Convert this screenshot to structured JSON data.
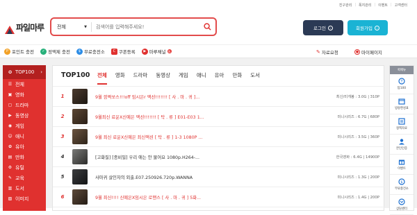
{
  "top_links": [
    "친구관리",
    "폭지관리",
    "이벤트",
    "고객센터"
  ],
  "logo": {
    "text": "파일마루"
  },
  "search": {
    "category": "전체",
    "placeholder": "검색어를 입력해주세요!"
  },
  "auth": {
    "login_label": "로그인",
    "join_label": "회원가입"
  },
  "quick": [
    {
      "label": "포인트 충전",
      "icon": "point-icon",
      "color": "#f2a126"
    },
    {
      "label": "정액제 충전",
      "icon": "flatrate-icon",
      "color": "#27b07a"
    },
    {
      "label": "무료충전소",
      "icon": "free-charge-icon",
      "color": "#2d8de6"
    },
    {
      "label": "쿠폰등록",
      "icon": "coupon-icon",
      "color": "#e0312f"
    },
    {
      "label": "마루채널",
      "icon": "channel-icon",
      "color": "#e0312f"
    }
  ],
  "quick_badge": "N",
  "quick_right": {
    "request": "자료요청",
    "mypage": "마이페이지"
  },
  "sidebar": {
    "top": "TOP100",
    "items": [
      "전체",
      "영화",
      "드라마",
      "동영상",
      "게임",
      "애니",
      "유아",
      "만화",
      "유틸",
      "교육",
      "도서",
      "이미지"
    ]
  },
  "main": {
    "title": "TOP100",
    "tabs": [
      "전체",
      "영화",
      "드라마",
      "동영상",
      "게임",
      "애니",
      "유아",
      "만화",
      "도서"
    ],
    "active_tab": 0
  },
  "rows": [
    {
      "rank": "1",
      "title": "9월 깜짝쏘스!!!off 임시은r 액션!!!!!!! [ 사 . 마 . 귀 ]...",
      "meta": "최신/미개봉 : 3.0G | 310P",
      "color": "#e0312f"
    },
    {
      "rank": "2",
      "title": "9월최신 료운X신예은 액션!!!!!!! [ 탁 . 류 ] E01-E03 1...",
      "meta": "미니시리즈 : 6.7G | 680P",
      "color": "#e0312f"
    },
    {
      "rank": "3",
      "title": "9월 최신 료운X신예은 최신액션 [ 탁 . 류 ] 1-3 1080P ...",
      "meta": "미니시리즈 : 3.5G | 360P",
      "color": "#e0312f"
    },
    {
      "rank": "4",
      "title": "[고화질] [종비밀] 우리 애는 안 물어요 1080p.H264-...",
      "meta": "한국영화 : 6.4G | 14900P",
      "color": "#333333"
    },
    {
      "rank": "5",
      "title": "사마귀 살인자의 외출.E07.250926.720p.WANNA",
      "meta": "미니시리즈 : 1.3G | 200P",
      "color": "#333333"
    },
    {
      "rank": "6",
      "title": "9월 최신!!!! 신예은X임시은 로맨스 [ 사 . 마 . 귀 ] 5화...",
      "meta": "미니시리즈 : 1.4G | 200P",
      "color": "#e0312f"
    }
  ],
  "rightnav": {
    "head": "퀵메뉴",
    "items": [
      {
        "label": "탑100",
        "icon": "top100-icon"
      },
      {
        "label": "방송편성표",
        "icon": "schedule-icon"
      },
      {
        "label": "정액자료",
        "icon": "flatrate-data-icon"
      },
      {
        "label": "본인인증",
        "icon": "verify-icon"
      },
      {
        "label": "이벤트",
        "icon": "event-icon"
      },
      {
        "label": "무료충전소",
        "icon": "free-charge-icon"
      },
      {
        "label": "상담센터",
        "icon": "support-icon"
      }
    ]
  }
}
